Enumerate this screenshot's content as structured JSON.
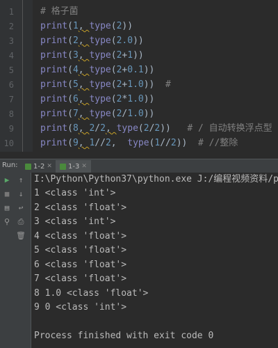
{
  "editor": {
    "line_numbers": [
      "1",
      "2",
      "3",
      "4",
      "5",
      "6",
      "7",
      "8",
      "9",
      "10"
    ],
    "comment_header": "# 格子菌",
    "lines": [
      [
        {
          "t": "print",
          "c": "fn"
        },
        {
          "t": "(",
          "c": "pl"
        },
        {
          "t": "1",
          "c": "num"
        },
        {
          "t": ", ",
          "c": "pl",
          "w": true
        },
        {
          "t": "type",
          "c": "fn"
        },
        {
          "t": "(",
          "c": "pl"
        },
        {
          "t": "2",
          "c": "num"
        },
        {
          "t": "))",
          "c": "pl"
        }
      ],
      [
        {
          "t": "print",
          "c": "fn"
        },
        {
          "t": "(",
          "c": "pl"
        },
        {
          "t": "2",
          "c": "num"
        },
        {
          "t": ", ",
          "c": "pl",
          "w": true
        },
        {
          "t": "type",
          "c": "fn"
        },
        {
          "t": "(",
          "c": "pl"
        },
        {
          "t": "2.0",
          "c": "num"
        },
        {
          "t": "))",
          "c": "pl"
        }
      ],
      [
        {
          "t": "print",
          "c": "fn"
        },
        {
          "t": "(",
          "c": "pl"
        },
        {
          "t": "3",
          "c": "num"
        },
        {
          "t": ", ",
          "c": "pl",
          "w": true
        },
        {
          "t": "type",
          "c": "fn"
        },
        {
          "t": "(",
          "c": "pl"
        },
        {
          "t": "2",
          "c": "num"
        },
        {
          "t": "+",
          "c": "pl"
        },
        {
          "t": "1",
          "c": "num"
        },
        {
          "t": "))",
          "c": "pl"
        }
      ],
      [
        {
          "t": "print",
          "c": "fn"
        },
        {
          "t": "(",
          "c": "pl"
        },
        {
          "t": "4",
          "c": "num"
        },
        {
          "t": ", ",
          "c": "pl",
          "w": true
        },
        {
          "t": "type",
          "c": "fn"
        },
        {
          "t": "(",
          "c": "pl"
        },
        {
          "t": "2",
          "c": "num"
        },
        {
          "t": "+",
          "c": "pl"
        },
        {
          "t": "0.1",
          "c": "num"
        },
        {
          "t": "))",
          "c": "pl"
        }
      ],
      [
        {
          "t": "print",
          "c": "fn"
        },
        {
          "t": "(",
          "c": "pl"
        },
        {
          "t": "5",
          "c": "num"
        },
        {
          "t": ", ",
          "c": "pl",
          "w": true
        },
        {
          "t": "type",
          "c": "fn"
        },
        {
          "t": "(",
          "c": "pl"
        },
        {
          "t": "2",
          "c": "num"
        },
        {
          "t": "+",
          "c": "pl"
        },
        {
          "t": "1.0",
          "c": "num"
        },
        {
          "t": "))  ",
          "c": "pl"
        },
        {
          "t": "#",
          "c": "cm"
        }
      ],
      [
        {
          "t": "print",
          "c": "fn"
        },
        {
          "t": "(",
          "c": "pl"
        },
        {
          "t": "6",
          "c": "num"
        },
        {
          "t": ", ",
          "c": "pl",
          "w": true
        },
        {
          "t": "type",
          "c": "fn"
        },
        {
          "t": "(",
          "c": "pl"
        },
        {
          "t": "2",
          "c": "num"
        },
        {
          "t": "*",
          "c": "pl"
        },
        {
          "t": "1.0",
          "c": "num"
        },
        {
          "t": "))",
          "c": "pl"
        }
      ],
      [
        {
          "t": "print",
          "c": "fn"
        },
        {
          "t": "(",
          "c": "pl"
        },
        {
          "t": "7",
          "c": "num"
        },
        {
          "t": ", ",
          "c": "pl",
          "w": true
        },
        {
          "t": "type",
          "c": "fn"
        },
        {
          "t": "(",
          "c": "pl"
        },
        {
          "t": "2",
          "c": "num"
        },
        {
          "t": "/",
          "c": "pl"
        },
        {
          "t": "1.0",
          "c": "num"
        },
        {
          "t": "))",
          "c": "pl"
        }
      ],
      [
        {
          "t": "print",
          "c": "fn"
        },
        {
          "t": "(",
          "c": "pl"
        },
        {
          "t": "8",
          "c": "num"
        },
        {
          "t": ", ",
          "c": "pl",
          "w": true
        },
        {
          "t": "2",
          "c": "num"
        },
        {
          "t": "/",
          "c": "pl"
        },
        {
          "t": "2",
          "c": "num"
        },
        {
          "t": ", ",
          "c": "pl",
          "w": true
        },
        {
          "t": "type",
          "c": "fn"
        },
        {
          "t": "(",
          "c": "pl"
        },
        {
          "t": "2",
          "c": "num"
        },
        {
          "t": "/",
          "c": "pl"
        },
        {
          "t": "2",
          "c": "num"
        },
        {
          "t": "))   ",
          "c": "pl"
        },
        {
          "t": "# / 自动转换浮点型",
          "c": "cm"
        }
      ],
      [
        {
          "t": "print",
          "c": "fn"
        },
        {
          "t": "(",
          "c": "pl"
        },
        {
          "t": "9",
          "c": "num"
        },
        {
          "t": ", ",
          "c": "pl",
          "w": true
        },
        {
          "t": "1",
          "c": "num"
        },
        {
          "t": "//",
          "c": "pl"
        },
        {
          "t": "2",
          "c": "num"
        },
        {
          "t": ",  ",
          "c": "pl"
        },
        {
          "t": "type",
          "c": "fn"
        },
        {
          "t": "(",
          "c": "pl"
        },
        {
          "t": "1",
          "c": "num"
        },
        {
          "t": "//",
          "c": "pl"
        },
        {
          "t": "2",
          "c": "num"
        },
        {
          "t": "))  ",
          "c": "pl"
        },
        {
          "t": "# //整除",
          "c": "cm"
        }
      ]
    ]
  },
  "run": {
    "label": "Run:",
    "tabs": [
      {
        "label": "1-2",
        "active": false
      },
      {
        "label": "1-3",
        "active": true
      }
    ],
    "command": "I:\\Python\\Python37\\python.exe J:/编程视频资料/pyth",
    "output": [
      "1 <class 'int'>",
      "2 <class 'float'>",
      "3 <class 'int'>",
      "4 <class 'float'>",
      "5 <class 'float'>",
      "6 <class 'float'>",
      "7 <class 'float'>",
      "8 1.0 <class 'float'>",
      "9 0 <class 'int'>"
    ],
    "exit_message": "Process finished with exit code 0"
  },
  "colors": {
    "keyword_fn": "#8888c6",
    "number": "#6897bb",
    "comment": "#808080",
    "plain": "#a9b7c6",
    "warning_underline": "#c9a227"
  },
  "icons": {
    "run": "play-icon",
    "rerun_up": "arrow-up-icon",
    "stop": "stop-icon",
    "scroll_down": "arrow-down-icon",
    "soft_wrap": "wrap-icon",
    "print": "print-icon",
    "pin": "pin-icon",
    "trash": "trash-icon"
  }
}
